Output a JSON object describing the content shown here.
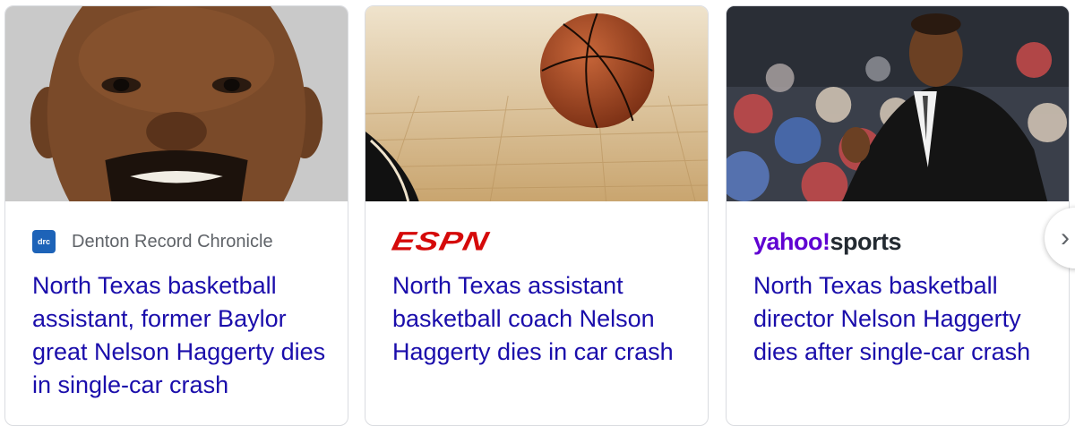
{
  "cards": [
    {
      "source": "Denton Record Chronicle",
      "favicon_text": "drc",
      "title": "North Texas basketball assistant, former Baylor great Nelson Haggerty dies in single-car crash"
    },
    {
      "source_logo": "ESPN",
      "title": "North Texas assistant basketball coach Nelson Haggerty dies in car crash"
    },
    {
      "source_logo_primary": "yahoo!",
      "source_logo_secondary": "sports",
      "title": "North Texas basketball director Nelson Haggerty dies after single-car crash"
    }
  ],
  "next_button": {
    "icon": "chevron-right-icon",
    "glyph": "›"
  },
  "colors": {
    "link": "#1a0dab",
    "source_text": "#5f6368",
    "espn_red": "#d50a0a",
    "yahoo_purple": "#6001d2"
  }
}
